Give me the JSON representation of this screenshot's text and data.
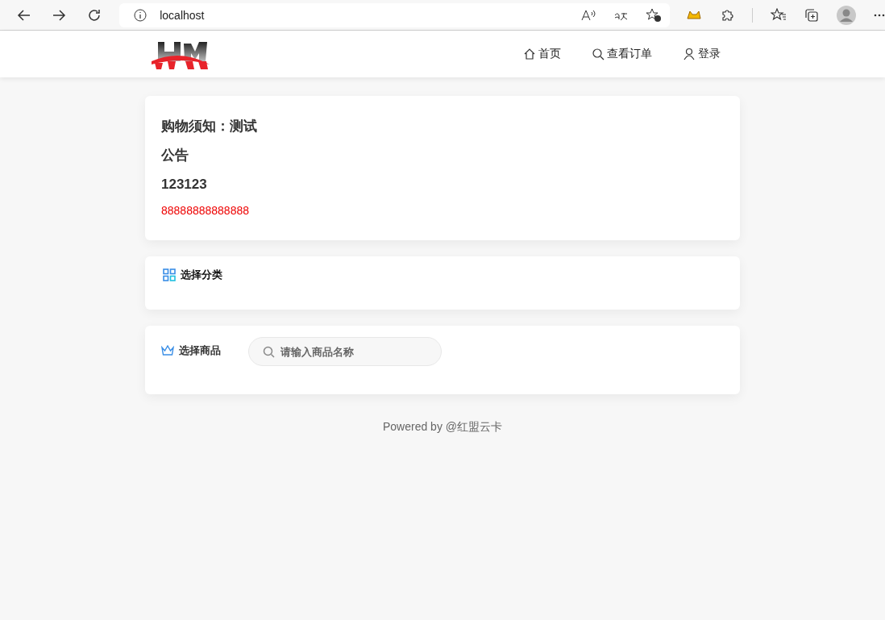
{
  "browser": {
    "address": "localhost"
  },
  "nav": [
    {
      "label": "首页"
    },
    {
      "label": "查看订单"
    },
    {
      "label": "登录"
    }
  ],
  "notice": {
    "title": "购物须知：测试",
    "heading": "公告",
    "number": "123123",
    "highlight": "88888888888888"
  },
  "category": {
    "title": "选择分类"
  },
  "goods": {
    "title": "选择商品",
    "search": {
      "placeholder": "请输入商品名称"
    }
  },
  "footer": "Powered by @红盟云卡"
}
